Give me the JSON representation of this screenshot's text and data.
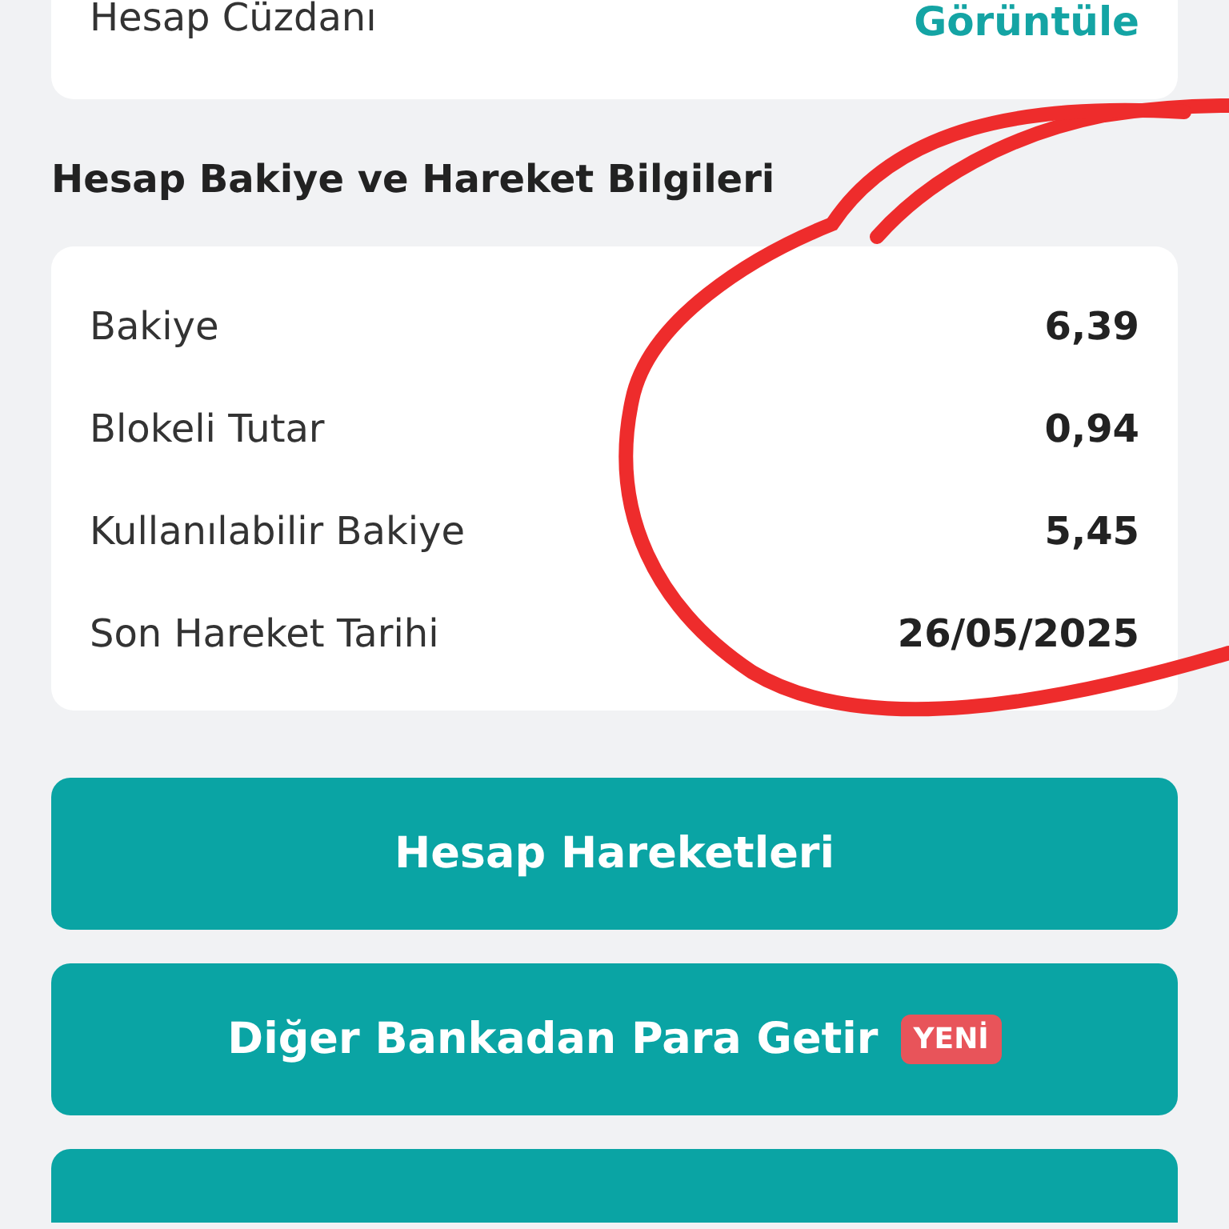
{
  "wallet_card": {
    "label": "Hesap Cüzdanı",
    "link": "Görüntüle"
  },
  "section_title": "Hesap Bakiye ve Hareket Bilgileri",
  "balance_rows": [
    {
      "label": "Bakiye",
      "value": "6,39"
    },
    {
      "label": "Blokeli Tutar",
      "value": "0,94"
    },
    {
      "label": "Kullanılabilir Bakiye",
      "value": "5,45"
    },
    {
      "label": "Son Hareket Tarihi",
      "value": "26/05/2025"
    }
  ],
  "buttons": [
    {
      "kind": "text",
      "label": "Hesap Hareketleri"
    },
    {
      "kind": "text",
      "label": "Diğer Bankadan Para Getir",
      "badge": "YENİ"
    },
    {
      "kind": "blank"
    }
  ]
}
